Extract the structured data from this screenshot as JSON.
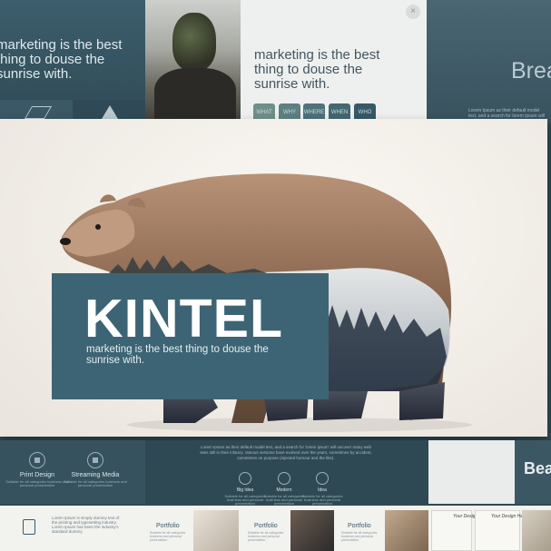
{
  "top_left_slide": {
    "heading": "marketing is the best thing to douse the sunrise with."
  },
  "top_middle_slide": {
    "heading": "marketing is the best thing to douse the sunrise with.",
    "close_glyph": "×",
    "buttons": [
      "WHAT",
      "WHY",
      "WHERE",
      "WHEN",
      "WHO"
    ]
  },
  "top_right_slide": {
    "title": "Brea",
    "body": "Lorem Ipsum as their default model text, and a search for lorem ipsum will"
  },
  "main_slide": {
    "title": "KINTEL",
    "subtitle": "marketing is the best thing to douse the sunrise with.",
    "title_box_color": "#3d6474"
  },
  "bottom_left_slide": {
    "features": [
      {
        "label": "Print Design",
        "desc": "Suitable for all categories business and personal presentation"
      },
      {
        "label": "Streaming Media",
        "desc": "Suitable for all categories business and personal presentation"
      }
    ]
  },
  "bottom_middle_slide": {
    "body": "Lorem Ipsum as their default model text, and a search for 'lorem ipsum' will uncover many web sites still in their infancy. Various versions have evolved over the years, sometimes by accident, sometimes on purpose (injected humour and the like).",
    "features": [
      {
        "label": "Big Idea",
        "desc": "Suitable for all categories business and personal presentation"
      },
      {
        "label": "Modern",
        "desc": "Suitable for all categories business and personal presentation"
      },
      {
        "label": "Idea",
        "desc": "Suitable for all categories business and personal presentation"
      }
    ]
  },
  "bottom_right_slide": {
    "letters": "Bea"
  },
  "strip": {
    "doc_text": "Lorem Ipsum is simply dummy text of the printing and typesetting industry. Lorem Ipsum has been the industry's standard dummy.",
    "portfolio": [
      {
        "title": "Portfolio",
        "desc": "Suitable for all categories business and personal presentation"
      },
      {
        "title": "Portfolio",
        "desc": "Suitable for all categories business and personal presentation"
      },
      {
        "title": "Portfolio",
        "desc": "Suitable for all categories business and personal presentation"
      }
    ],
    "notes": [
      "Your Design Here",
      "Your Design Here"
    ]
  }
}
